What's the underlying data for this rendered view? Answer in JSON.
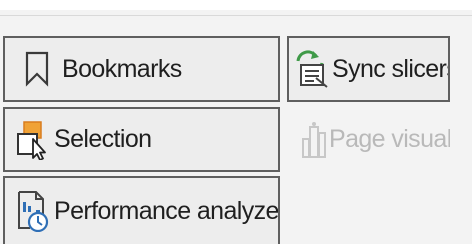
{
  "ribbon": {
    "buttons": [
      {
        "label": "Bookmarks",
        "icon": "bookmark-icon",
        "enabled": true
      },
      {
        "label": "Sync slicers",
        "icon": "sync-slicers-icon",
        "enabled": true
      },
      {
        "label": "Selection",
        "icon": "selection-icon",
        "enabled": true
      },
      {
        "label": "Page visuals",
        "icon": "page-visuals-icon",
        "enabled": false
      },
      {
        "label": "Performance analyzer",
        "icon": "performance-analyzer-icon",
        "enabled": true
      }
    ]
  },
  "colors": {
    "background": "#f3f3f3",
    "button_face": "#ededed",
    "button_border": "#5f5f5f",
    "text": "#1f1f1f",
    "disabled_text": "#b9b9b9",
    "accent_orange": "#f0a236",
    "accent_green": "#3f9a48",
    "accent_blue": "#2f6fb6"
  }
}
